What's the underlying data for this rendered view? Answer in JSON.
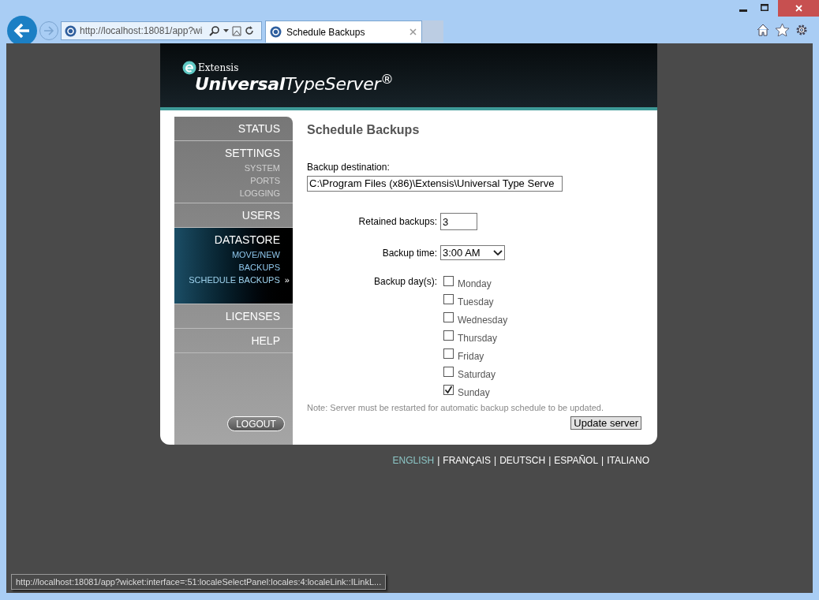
{
  "browser": {
    "address": "http://localhost:18081/app?wi",
    "tabs": [
      {
        "title": "Schedule Backups",
        "selected": true
      }
    ],
    "status_url": "http://localhost:18081/app?wicket:interface=:51:localeSelectPanel:locales:4:localeLink::ILinkL..."
  },
  "logo": {
    "brand": "Extensis",
    "product": "**Universal**TypeServer$^{®}$"
  },
  "sidebar": {
    "selected_marker": "»",
    "sections": [
      {
        "label": "STATUS",
        "selected": false
      },
      {
        "label": "SETTINGS",
        "selected": false,
        "children": [
          {
            "label": "SYSTEM",
            "selected": false
          },
          {
            "label": "PORTS",
            "selected": false
          },
          {
            "label": "LOGGING",
            "selected": false
          }
        ]
      },
      {
        "label": "USERS",
        "selected": false
      },
      {
        "label": "DATASTORE",
        "selected": true,
        "children": [
          {
            "label": "MOVE/NEW",
            "selected": false
          },
          {
            "label": "BACKUPS",
            "selected": false
          },
          {
            "label": "SCHEDULE BACKUPS",
            "selected": true
          }
        ]
      },
      {
        "label": "LICENSES",
        "selected": false
      },
      {
        "label": "HELP",
        "selected": false
      }
    ],
    "logout": "LOGOUT"
  },
  "form": {
    "title": "Schedule Backups",
    "destination_label": "Backup destination:",
    "destination_value": "C:\\Program Files (x86)\\Extensis\\Universal Type Serve",
    "retained_label": "Retained backups:",
    "retained_value": "3",
    "time_label": "Backup time:",
    "time_value": "3:00 AM",
    "days_label": "Backup day(s):",
    "days": [
      {
        "label": "Monday",
        "checked": false
      },
      {
        "label": "Tuesday",
        "checked": false
      },
      {
        "label": "Wednesday",
        "checked": false
      },
      {
        "label": "Thursday",
        "checked": false
      },
      {
        "label": "Friday",
        "checked": false
      },
      {
        "label": "Saturday",
        "checked": false
      },
      {
        "label": "Sunday",
        "checked": true
      }
    ],
    "note": "Note: Server must be restarted for automatic backup schedule to be updated.",
    "submit": "Update server"
  },
  "languages": [
    {
      "kind": "link",
      "label": "ENGLISH",
      "selected": true
    },
    {
      "kind": "separator",
      "label": "|"
    },
    {
      "kind": "link",
      "label": "FRANÇAIS",
      "selected": false
    },
    {
      "kind": "separator",
      "label": "|"
    },
    {
      "kind": "link",
      "label": "DEUTSCH",
      "selected": false
    },
    {
      "kind": "separator",
      "label": "|"
    },
    {
      "kind": "link",
      "label": "ESPAÑOL",
      "selected": false
    },
    {
      "kind": "separator",
      "label": "|"
    },
    {
      "kind": "link",
      "label": "ITALIANO",
      "selected": false
    }
  ]
}
